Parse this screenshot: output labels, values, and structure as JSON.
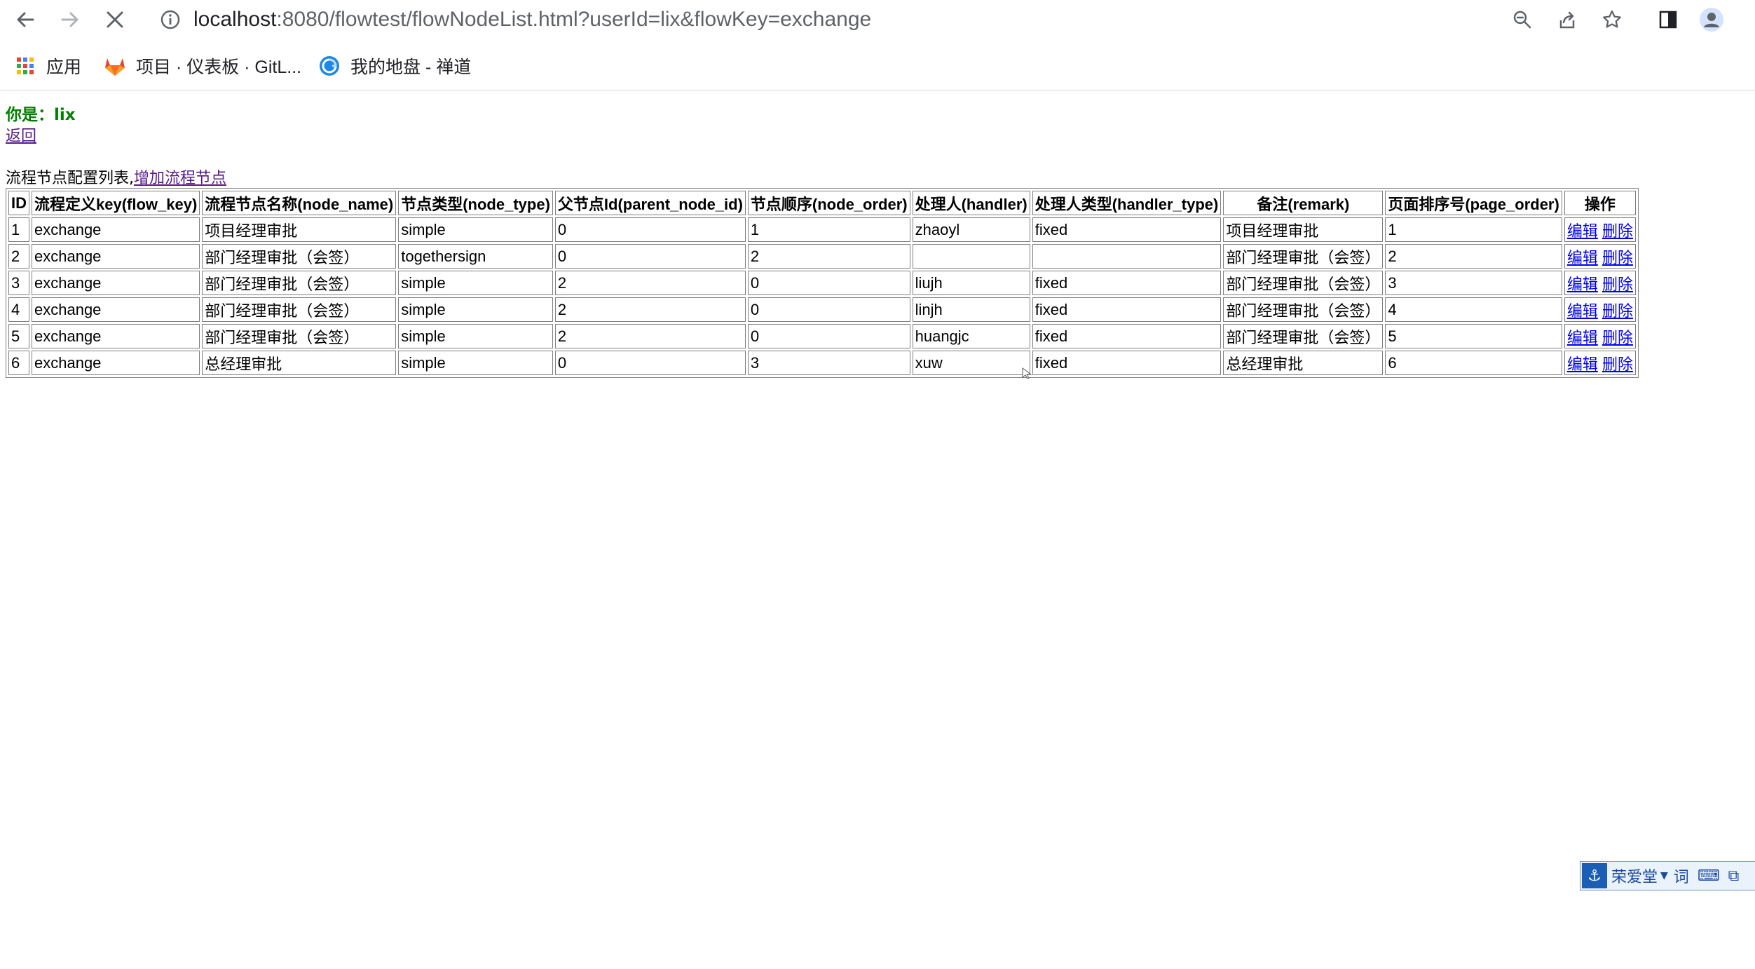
{
  "browser": {
    "url_host": "localhost",
    "url_path": ":8080/flowtest/flowNodeList.html?userId=lix&flowKey=exchange",
    "bookmarks": [
      {
        "label": "应用",
        "icon": "apps-grid-icon"
      },
      {
        "label": "项目 · 仪表板 · GitL...",
        "icon": "gitlab-icon"
      },
      {
        "label": "我的地盘 - 禅道",
        "icon": "zentao-icon"
      }
    ]
  },
  "page": {
    "user_prefix": "你是：",
    "user_name": "lix",
    "back_label": "返回",
    "list_caption": "流程节点配置列表,",
    "add_node_label": "增加流程节点"
  },
  "table": {
    "headers": [
      "ID",
      "流程定义key(flow_key)",
      "流程节点名称(node_name)",
      "节点类型(node_type)",
      "父节点Id(parent_node_id)",
      "节点顺序(node_order)",
      "处理人(handler)",
      "处理人类型(handler_type)",
      "备注(remark)",
      "页面排序号(page_order)",
      "操作"
    ],
    "edit_label": "编辑",
    "delete_label": "删除",
    "rows": [
      [
        "1",
        "exchange",
        "项目经理审批",
        "simple",
        "0",
        "1",
        "zhaoyl",
        "fixed",
        "项目经理审批",
        "1"
      ],
      [
        "2",
        "exchange",
        "部门经理审批（会签）",
        "togethersign",
        "0",
        "2",
        "",
        "",
        "部门经理审批（会签）",
        "2"
      ],
      [
        "3",
        "exchange",
        "部门经理审批（会签）",
        "simple",
        "2",
        "0",
        "liujh",
        "fixed",
        "部门经理审批（会签）",
        "3"
      ],
      [
        "4",
        "exchange",
        "部门经理审批（会签）",
        "simple",
        "2",
        "0",
        "linjh",
        "fixed",
        "部门经理审批（会签）",
        "4"
      ],
      [
        "5",
        "exchange",
        "部门经理审批（会签）",
        "simple",
        "2",
        "0",
        "huangjc",
        "fixed",
        "部门经理审批（会签）",
        "5"
      ],
      [
        "6",
        "exchange",
        "总经理审批",
        "simple",
        "0",
        "3",
        "xuw",
        "fixed",
        "总经理审批",
        "6"
      ]
    ]
  },
  "dict_widget": {
    "name": "荣爱堂",
    "word_label": "词"
  }
}
